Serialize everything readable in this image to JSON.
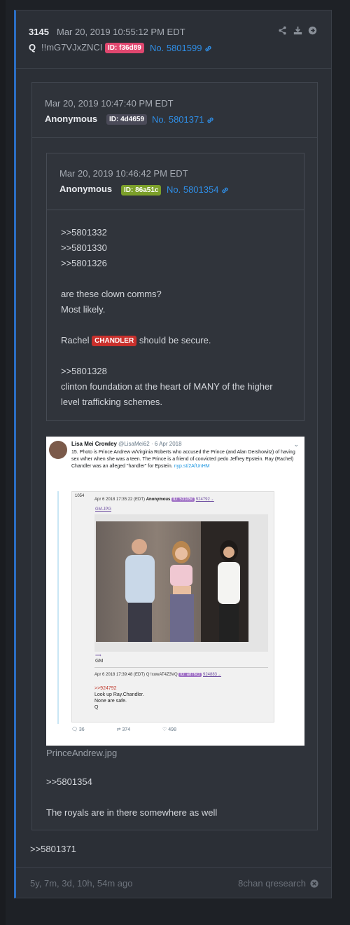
{
  "post": {
    "number": "3145",
    "date": "Mar 20, 2019 10:55:12 PM EDT",
    "name": "Q",
    "tripcode": "!!mG7VJxZNCI",
    "id": "ID: f36d89",
    "post_no": "No. 5801599",
    "reply_text": ">>5801371",
    "age": "5y, 7m, 3d, 10h, 54m ago",
    "board": "8chan qresearch",
    "id_color": "#e0476f"
  },
  "quote1": {
    "date": "Mar 20, 2019 10:47:40 PM EDT",
    "name": "Anonymous",
    "id": "ID: 4d4659",
    "post_no": "No. 5801371",
    "file_name": "PrinceAndrew.jpg",
    "reply_ref": ">>5801354",
    "text": "The royals are in there somewhere as well"
  },
  "quote2": {
    "date": "Mar 20, 2019 10:46:42 PM EDT",
    "name": "Anonymous",
    "id": "ID: 86a51c",
    "post_no": "No. 5801354",
    "refs": [
      ">>5801332",
      ">>5801330",
      ">>5801326"
    ],
    "line1": "are these clown comms?",
    "line2": "Most likely.",
    "rachel_pre": "Rachel",
    "rachel_tag": "CHANDLER",
    "rachel_post": "should be secure.",
    "ref4": ">>5801328",
    "line3": "clinton foundation at the heart of MANY of the higher",
    "line4": "level trafficking schemes."
  },
  "tweet": {
    "author": "Lisa Mei Crowley",
    "handle": "@LisaMei62 · 6 Apr 2018",
    "text": "15. Photo is Prince Andrew w/Virginia Roberts who accused the Prince (and Alan Dershowitz) of having sex w/her when she was a teen. The Prince is a friend of convicted pedo Jeffrey Epstein. Ray (Rachel) Chandler was an alleged \"handler\" for Epstein.",
    "link": "nyp.st/2AfUnHM",
    "card_num": "1054",
    "card_date": "Apr 6 2018 17:35:22 (EDT)",
    "card_name": "Anonymous",
    "card_id": "ID: 531d5c",
    "card_ref": "924792→",
    "card_file": "GM.JPG",
    "card_arrow": "⟹",
    "card_gm": "GM",
    "reply_date": "Apr 6 2018 17:39:48 (EDT)",
    "reply_name": "Q !xowAT4Z3VQ",
    "reply_id": "ID: a876c2",
    "reply_ref": "924883→",
    "reply_gt": ">>924792",
    "reply_l1": "Look up Ray.Chandler.",
    "reply_l2": "None are safe.",
    "reply_l3": "Q",
    "replies": "36",
    "retweets": "374",
    "likes": "498"
  }
}
